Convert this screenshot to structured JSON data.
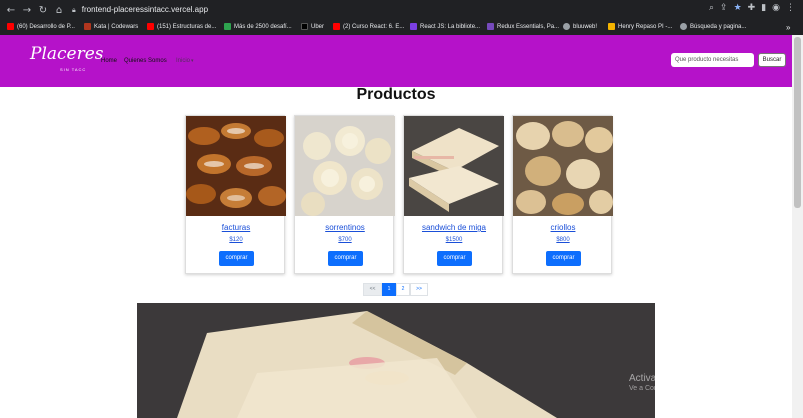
{
  "browser": {
    "url": "frontend-placeressintacc.vercel.app",
    "bookmarks": [
      {
        "label": "(60) Desarrollo de P...",
        "color": "#ff0000"
      },
      {
        "label": "Kata | Codewars",
        "color": "#b1361e"
      },
      {
        "label": "(151) Estructuras de...",
        "color": "#ff0000"
      },
      {
        "label": "Más de 2500 desafí...",
        "color": "#2ea44f"
      },
      {
        "label": "Uber",
        "color": "#000000"
      },
      {
        "label": "(2) Curso React: 6. E...",
        "color": "#ff0000"
      },
      {
        "label": "React JS: La bibliote...",
        "color": "#7b3fe4"
      },
      {
        "label": "Redux Essentials, Pa...",
        "color": "#764abc"
      },
      {
        "label": "bluuweb!",
        "color": "#9aa0a6"
      },
      {
        "label": "Henry Repaso PI -...",
        "color": "#f4b400"
      },
      {
        "label": "Búsqueda y pagina...",
        "color": "#9aa0a6"
      }
    ]
  },
  "navbar": {
    "logo": "Placeres",
    "logo_sub": "SIN TACC",
    "links": [
      "Home",
      "Quienes Somos",
      "Inicio"
    ],
    "search_placeholder": "Que producto necesitas",
    "search_button": "Buscar",
    "bg_color": "#b512c9"
  },
  "page": {
    "title": "Productos",
    "products": [
      {
        "name": "facturas",
        "price": "$120",
        "button": "comprar"
      },
      {
        "name": "sorrentinos",
        "price": "$700",
        "button": "comprar"
      },
      {
        "name": "sandwich de miga",
        "price": "$1500",
        "button": "comprar"
      },
      {
        "name": "criollos",
        "price": "$800",
        "button": "comprar"
      }
    ],
    "pagination": {
      "prev": "<<",
      "pages": [
        "1",
        "2"
      ],
      "next": ">>",
      "current": "1"
    }
  },
  "watermark": {
    "line1": "Activar Windows",
    "line2": "Ve a Configuración para activar Windows."
  }
}
